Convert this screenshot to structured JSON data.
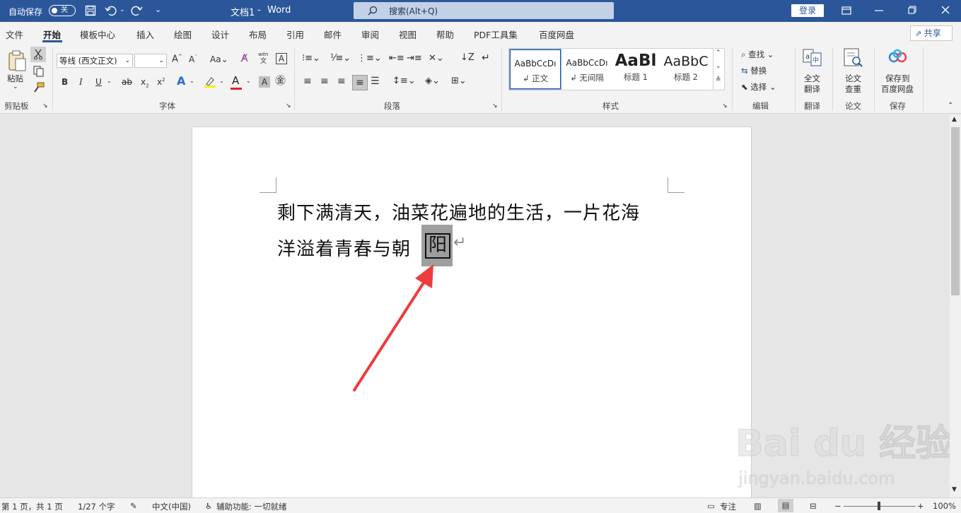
{
  "titlebar": {
    "autosave_label": "自动保存",
    "autosave_state": "关",
    "doc_title": "文档1",
    "separator": "-",
    "app_name": "Word",
    "search_placeholder": "搜索(Alt+Q)",
    "login_label": "登录",
    "accent_color": "#2b579a"
  },
  "tabs": [
    "文件",
    "开始",
    "模板中心",
    "插入",
    "绘图",
    "设计",
    "布局",
    "引用",
    "邮件",
    "审阅",
    "视图",
    "帮助",
    "PDF工具集",
    "百度网盘"
  ],
  "active_tab": "开始",
  "share_label": "共享",
  "ribbon": {
    "clipboard": {
      "paste_label": "粘贴",
      "group_label": "剪贴板"
    },
    "font": {
      "font_name": "等线 (西文正文)",
      "font_size": "",
      "group_label": "字体",
      "pinyin_label": "wén"
    },
    "paragraph": {
      "group_label": "段落"
    },
    "styles": {
      "group_label": "样式",
      "items": [
        {
          "preview": "AaBbCcDı",
          "name": "正文"
        },
        {
          "preview": "AaBbCcDı",
          "name": "无间隔"
        },
        {
          "preview": "AaBl",
          "name": "标题 1"
        },
        {
          "preview": "AaBbC",
          "name": "标题 2"
        }
      ]
    },
    "editing": {
      "find": "查找",
      "replace": "替换",
      "select": "选择",
      "group_label": "编辑"
    },
    "translate": {
      "label1": "全文",
      "label2": "翻译",
      "group_label": "翻译"
    },
    "paper": {
      "label1": "论文",
      "label2": "查重",
      "group_label": "论文"
    },
    "save": {
      "label1": "保存到",
      "label2": "百度网盘",
      "group_label": "保存"
    }
  },
  "document": {
    "line1": "剩下满清天，油菜花遍地的生活，一片花海",
    "line2_prefix": "洋溢着青春与朝",
    "selected_char": "阳",
    "paragraph_mark": "↵"
  },
  "statusbar": {
    "page": "第 1 页，共 1 页",
    "words": "1/27 个字",
    "language": "中文(中国)",
    "accessibility": "辅助功能: 一切就绪",
    "focus": "专注",
    "zoom": "100%"
  },
  "watermark": {
    "line1": "Bai du 经验",
    "line2": "jingyan.baidu.com"
  }
}
